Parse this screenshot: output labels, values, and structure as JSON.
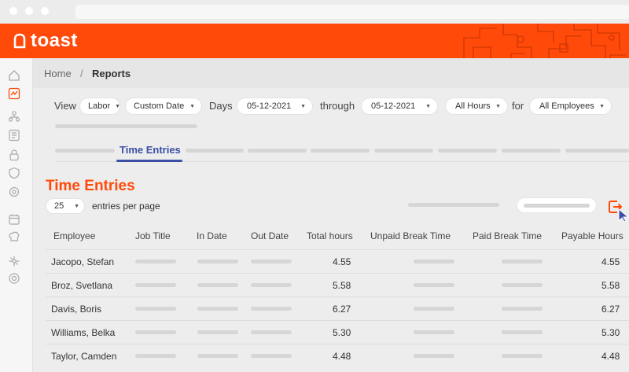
{
  "brand": {
    "name": "toast",
    "color": "#ff4a0a"
  },
  "sidebar": {
    "icons": [
      "home-icon",
      "reports-icon",
      "org-icon",
      "menu-icon",
      "lock-icon",
      "shield-icon",
      "settings-icon",
      "calendar-icon",
      "chef-icon",
      "network-icon",
      "support-icon"
    ]
  },
  "breadcrumb": {
    "home": "Home",
    "separator": "/",
    "current": "Reports"
  },
  "filters": {
    "view_label": "View",
    "view_value": "Labor",
    "date_range": "Custom Date",
    "days_label": "Days",
    "start_date": "05-12-2021",
    "through_label": "through",
    "end_date": "05-12-2021",
    "hours": "All Hours",
    "for_label": "for",
    "employees": "All Employees"
  },
  "tabs": {
    "active": "Time Entries",
    "accent": "#3b4fa5"
  },
  "section": {
    "title": "Time Entries",
    "per_page_value": "25",
    "per_page_label": "entries per page"
  },
  "table": {
    "headers": [
      "Employee",
      "Job Title",
      "In Date",
      "Out Date",
      "Total hours",
      "Unpaid Break Time",
      "Paid Break Time",
      "Payable Hours"
    ],
    "rows": [
      {
        "employee": "Jacopo, Stefan",
        "total": "4.55",
        "payable": "4.55"
      },
      {
        "employee": "Broz, Svetlana",
        "total": "5.58",
        "payable": "5.58"
      },
      {
        "employee": "Davis, Boris",
        "total": "6.27",
        "payable": "6.27"
      },
      {
        "employee": "Williams, Belka",
        "total": "5.30",
        "payable": "5.30"
      },
      {
        "employee": "Taylor, Camden",
        "total": "4.48",
        "payable": "4.48"
      }
    ]
  }
}
